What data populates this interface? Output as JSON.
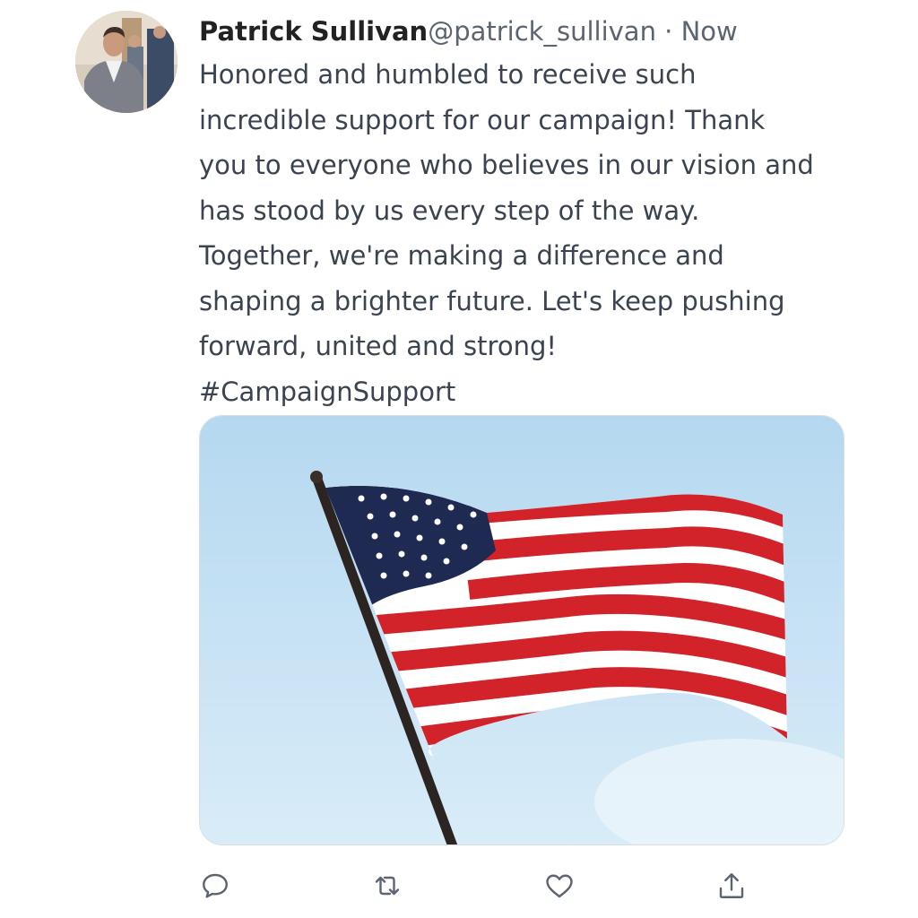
{
  "tweet": {
    "author_name": "Patrick Sullivan",
    "author_handle": "@patrick_sullivan",
    "separator": "·",
    "timestamp": "Now",
    "text": "Honored and humbled to receive such incredible support for our campaign! Thank you to everyone who believes in our vision and has stood by us every step of the way. Together, we're making a difference and shaping a brighter future. Let's keep pushing forward, united and strong!",
    "hashtag": "#CampaignSupport"
  },
  "media": {
    "description_icon": "american-flag-photo"
  },
  "actions": [
    {
      "icon": "reply-icon"
    },
    {
      "icon": "retweet-icon"
    },
    {
      "icon": "like-icon"
    },
    {
      "icon": "share-icon"
    }
  ],
  "colors": {
    "text": "#3b4350",
    "muted": "#5b6470",
    "icon": "#5b6470",
    "border": "#d9dde2"
  }
}
